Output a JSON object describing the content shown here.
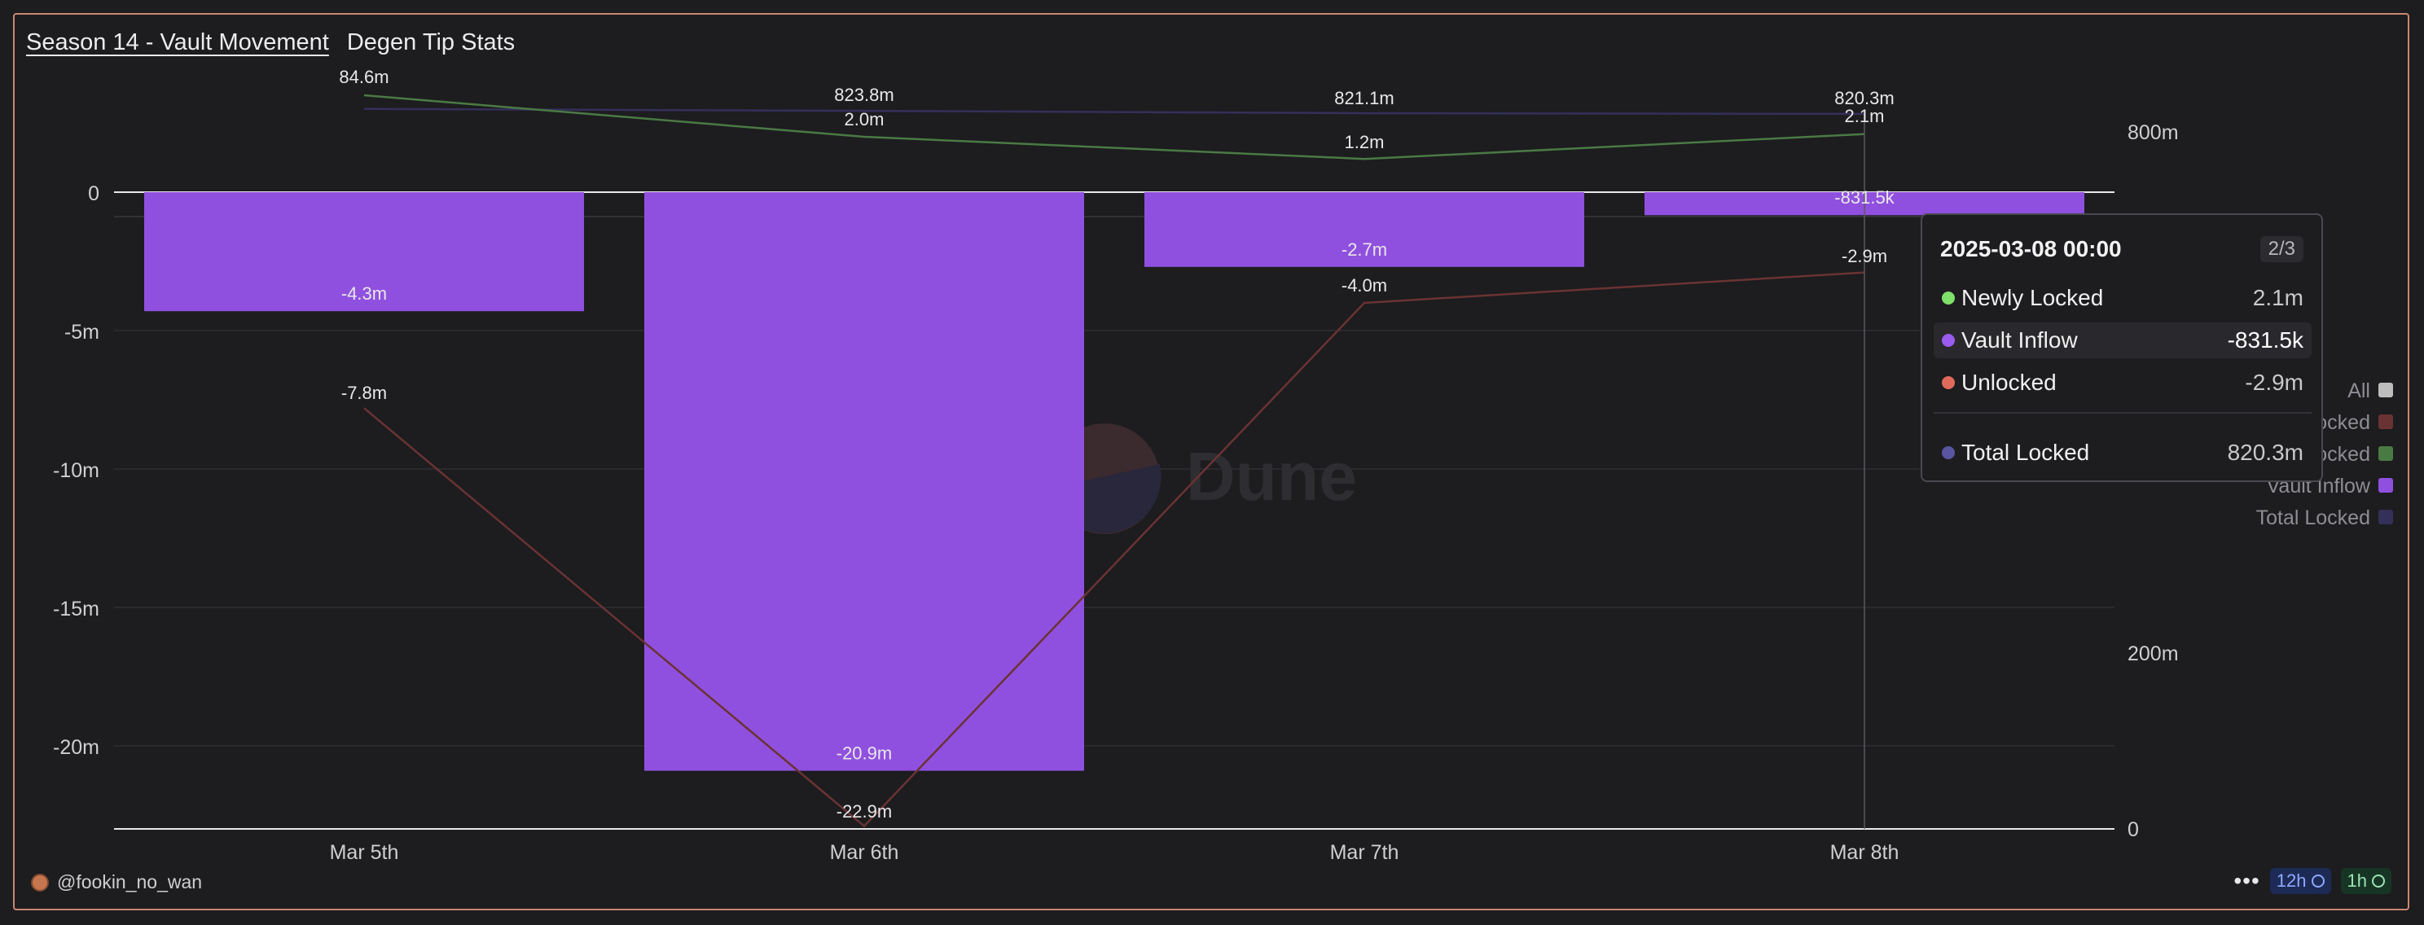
{
  "tabs": [
    {
      "label": "Season 14 - Vault Movement",
      "active": true
    },
    {
      "label": "Degen Tip Stats",
      "active": false
    }
  ],
  "watermark": "Dune",
  "colors": {
    "vault_inflow": "#9050df",
    "unlocked": "#6a3333",
    "newly_locked": "#4a7a44",
    "total_locked": "#34305a",
    "tooltip_newly": "#7fe06a",
    "tooltip_vault": "#9a5cf0",
    "tooltip_unlocked": "#e06a5a",
    "tooltip_total": "#5a55a0"
  },
  "chart_data": {
    "type": "bar",
    "categories": [
      "Mar 5th",
      "Mar 6th",
      "Mar 7th",
      "Mar 8th"
    ],
    "left_axis": {
      "ticks": [
        "0",
        "-5m",
        "-10m",
        "-15m",
        "-20m"
      ],
      "ylim": [
        -23000000,
        3500000
      ]
    },
    "right_axis": {
      "ticks": [
        "800m",
        "200m",
        "0"
      ],
      "ylim": [
        0,
        920000000
      ]
    },
    "series": [
      {
        "name": "Vault Inflow",
        "type": "bar",
        "axis": "left",
        "values": [
          -4300000,
          -20900000,
          -2700000,
          -831500
        ],
        "labels": [
          "-4.3m",
          "-20.9m",
          "-2.7m",
          "-831.5k"
        ]
      },
      {
        "name": "Unlocked",
        "type": "line",
        "axis": "left",
        "values": [
          -7800000,
          -22900000,
          -4000000,
          -2900000
        ],
        "labels": [
          "-7.8m",
          "-22.9m",
          "-4.0m",
          "-2.9m"
        ]
      },
      {
        "name": "Newly Locked",
        "type": "line",
        "axis": "left",
        "values": [
          3500000,
          2000000,
          1200000,
          2100000
        ],
        "labels": [
          "",
          "2.0m",
          "1.2m",
          "2.1m"
        ]
      },
      {
        "name": "Total Locked",
        "type": "line",
        "axis": "right",
        "values": [
          826000000,
          823800000,
          821100000,
          820300000
        ],
        "labels": [
          "",
          "823.8m",
          "821.1m",
          "820.3m"
        ]
      }
    ],
    "overlap_label": "84.6m",
    "legend": {
      "position": "right",
      "items": [
        "All",
        "Unlocked",
        "Newly Locked",
        "Vault Inflow",
        "Total Locked"
      ]
    },
    "grid": true
  },
  "tooltip": {
    "date": "2025-03-08 00:00",
    "page": "2/3",
    "rows": [
      {
        "label": "Newly Locked",
        "value": "2.1m"
      },
      {
        "label": "Vault Inflow",
        "value": "-831.5k"
      },
      {
        "label": "Unlocked",
        "value": "-2.9m"
      }
    ],
    "total": {
      "label": "Total Locked",
      "value": "820.3m"
    }
  },
  "footer": {
    "username": "@fookin_no_wan",
    "more_icon": "ellipsis-icon",
    "refresh_badge": "12h",
    "cache_badge": "1h"
  }
}
